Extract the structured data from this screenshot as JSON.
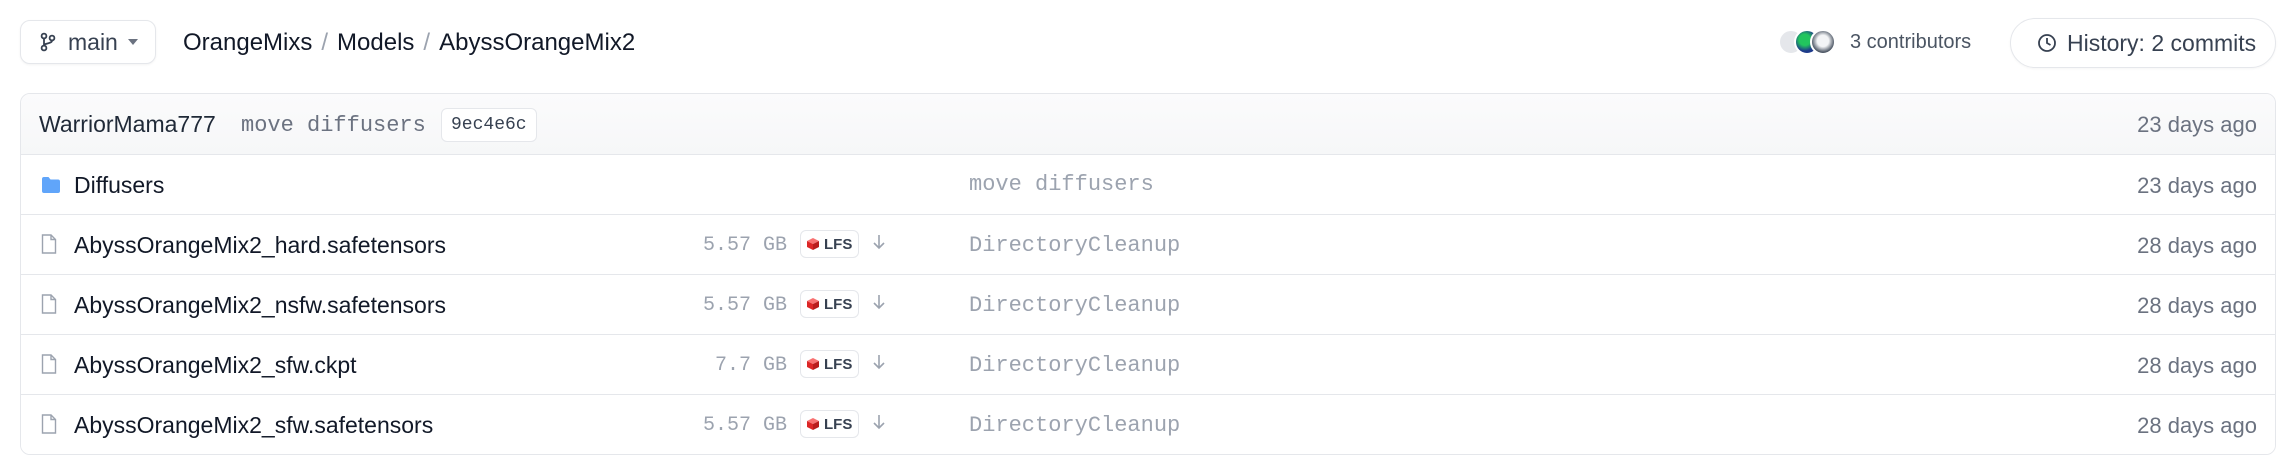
{
  "branch": {
    "label": "main"
  },
  "breadcrumb": {
    "items": [
      "OrangeMixs",
      "Models",
      "AbyssOrangeMix2"
    ],
    "separator": "/"
  },
  "contributors": {
    "label": "3 contributors"
  },
  "history": {
    "label": "History: 2 commits"
  },
  "last_commit": {
    "author": "WarriorMama777",
    "message": "move diffusers",
    "sha": "9ec4e6c",
    "time": "23 days ago"
  },
  "files": [
    {
      "type": "folder",
      "name": "Diffusers",
      "size": "",
      "lfs": "",
      "message": "move diffusers",
      "time": "23 days ago"
    },
    {
      "type": "file",
      "name": "AbyssOrangeMix2_hard.safetensors",
      "size": "5.57 GB",
      "lfs": "LFS",
      "message": "DirectoryCleanup",
      "time": "28 days ago"
    },
    {
      "type": "file",
      "name": "AbyssOrangeMix2_nsfw.safetensors",
      "size": "5.57 GB",
      "lfs": "LFS",
      "message": "DirectoryCleanup",
      "time": "28 days ago"
    },
    {
      "type": "file",
      "name": "AbyssOrangeMix2_sfw.ckpt",
      "size": "7.7 GB",
      "lfs": "LFS",
      "message": "DirectoryCleanup",
      "time": "28 days ago"
    },
    {
      "type": "file",
      "name": "AbyssOrangeMix2_sfw.safetensors",
      "size": "5.57 GB",
      "lfs": "LFS",
      "message": "DirectoryCleanup",
      "time": "28 days ago"
    }
  ],
  "colors": {
    "folder": "#60a5fa",
    "lfs_icon": "#dc2626",
    "border": "#e5e7eb",
    "muted": "#9ca3af"
  },
  "icons": {
    "branch": "git-branch-icon",
    "caret": "chevron-down-icon",
    "history": "clock-icon",
    "folder": "folder-icon",
    "file": "file-icon",
    "lfs": "lfs-cube-icon",
    "download": "download-arrow-icon"
  }
}
